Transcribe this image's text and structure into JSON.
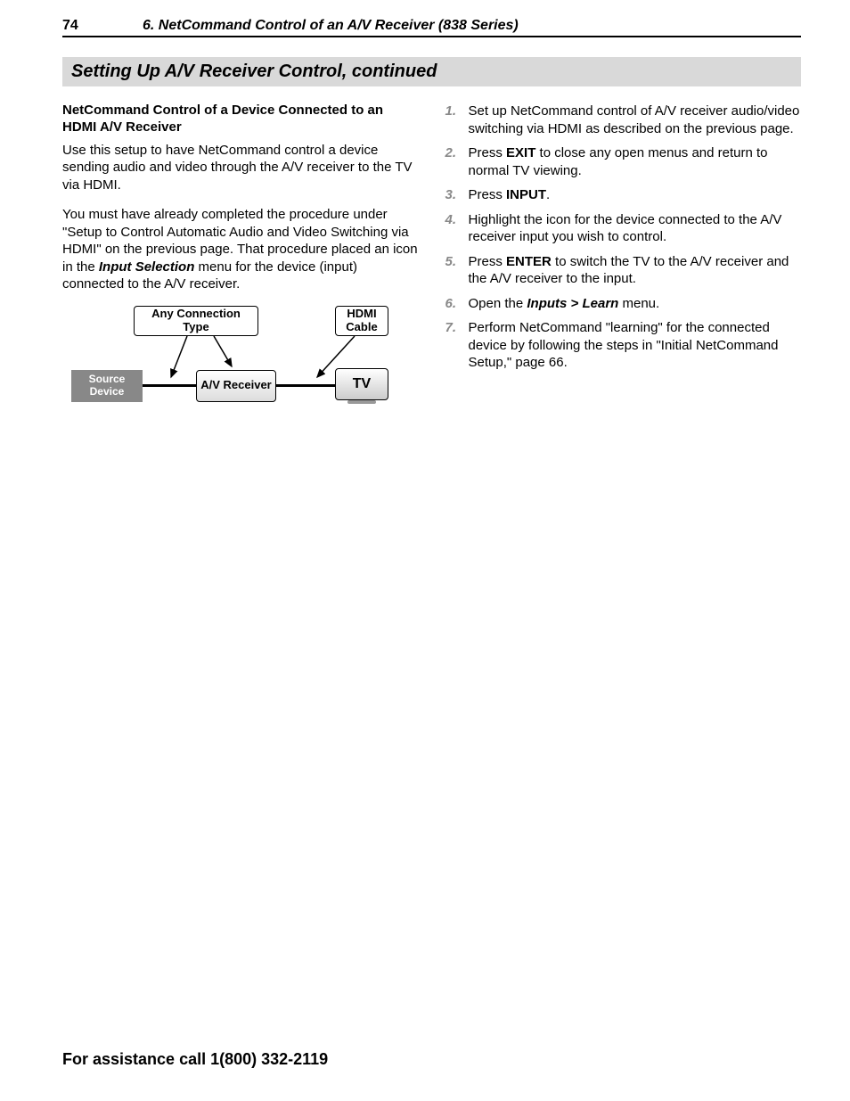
{
  "header": {
    "page_number": "74",
    "chapter": "6.  NetCommand Control of an A/V Receiver (838 Series)"
  },
  "section_title": "Setting Up A/V Receiver Control, continued",
  "left": {
    "sub_heading": "NetCommand Control of a Device Connected to an HDMI A/V Receiver",
    "para1": "Use this setup to have NetCommand control a device sending audio and video through the A/V receiver to the TV via HDMI.",
    "para2_a": "You must have already completed the procedure under \"Setup to Control Automatic Audio and Video Switching via HDMI\" on the previous page.  That procedure placed an icon in the ",
    "para2_bold": "Input Selection",
    "para2_b": " menu for the device (input) connected to the A/V receiver.",
    "diagram": {
      "conn_label": "Any Connection Type",
      "hdmi_label": "HDMI Cable",
      "source_label": "Source Device",
      "avr_label": "A/V Receiver",
      "tv_label": "TV"
    }
  },
  "steps": [
    {
      "n": "1.",
      "a": "Set up NetCommand control of A/V receiver audio/video switching via HDMI as described on the previous page."
    },
    {
      "n": "2.",
      "a": "Press ",
      "key": "EXIT",
      "b": " to close any open menus and return to normal TV viewing."
    },
    {
      "n": "3.",
      "a": "Press ",
      "key": "INPUT",
      "b": "."
    },
    {
      "n": "4.",
      "a": "Highlight the icon for the device connected to the A/V receiver input you wish to control."
    },
    {
      "n": "5.",
      "a": "Press ",
      "key": "ENTER",
      "b": " to switch the TV to the A/V receiver and the A/V receiver to the input."
    },
    {
      "n": "6.",
      "a": "Open the ",
      "menu": "Inputs > Learn",
      "b": " menu."
    },
    {
      "n": "7.",
      "a": "Perform NetCommand \"learning\" for the connected device by following the steps in \"Initial NetCommand Setup,\" page 66."
    }
  ],
  "footer": "For assistance call 1(800) 332-2119"
}
